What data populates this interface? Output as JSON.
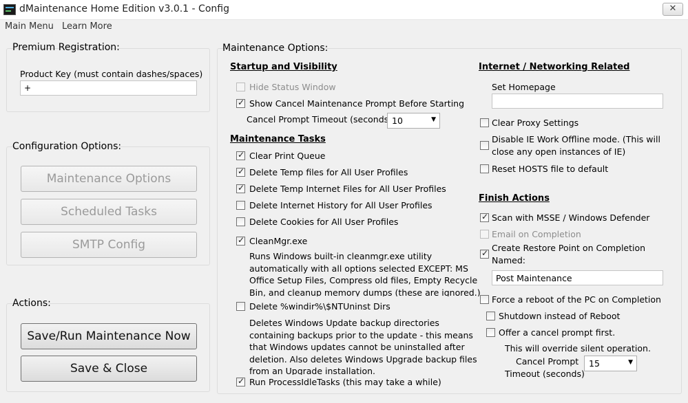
{
  "window": {
    "title": "dMaintenance Home Edition   v3.0.1  -  Config",
    "close_glyph": "✕"
  },
  "menu": {
    "items": [
      "Main Menu",
      "Learn More"
    ]
  },
  "premium": {
    "title": "Premium Registration:",
    "product_key_label": "Product Key  (must contain dashes/spaces)",
    "product_key_value": "+"
  },
  "config": {
    "title": "Configuration Options:",
    "buttons": [
      "Maintenance Options",
      "Scheduled Tasks",
      "SMTP Config"
    ]
  },
  "actions": {
    "title": "Actions:",
    "buttons": [
      "Save/Run Maintenance Now",
      "Save & Close"
    ]
  },
  "maintenance": {
    "title": "Maintenance Options:",
    "startup": {
      "heading": "Startup and Visibility",
      "hide_status": {
        "label": "Hide Status Window",
        "checked": false,
        "disabled": true
      },
      "show_cancel": {
        "label": "Show Cancel Maintenance Prompt Before Starting",
        "checked": true
      },
      "timeout_label": "Cancel Prompt Timeout (seconds)",
      "timeout_value": "10"
    },
    "tasks": {
      "heading": "Maintenance Tasks",
      "clear_print": {
        "label": "Clear Print Queue",
        "checked": true
      },
      "del_temp": {
        "label": "Delete Temp files for All User Profiles",
        "checked": true
      },
      "del_temp_inet": {
        "label": "Delete Temp Internet Files for All User Profiles",
        "checked": true
      },
      "del_history": {
        "label": "Delete Internet History for All User Profiles",
        "checked": false
      },
      "del_cookies": {
        "label": "Delete Cookies for All User Profiles",
        "checked": false
      },
      "cleanmgr": {
        "label": "CleanMgr.exe",
        "checked": true,
        "desc": "Runs Windows built-in cleanmgr.exe utility automatically with all options selected EXCEPT:  MS Office Setup Files, Compress old files, Empty Recycle Bin, and cleanup memory dumps (these are ignored.)"
      },
      "ntuninst": {
        "label": "Delete %windir%\\$NTUninst Dirs",
        "checked": false,
        "desc": "Deletes Windows Update backup directories containing backups prior to the update - this means that Windows updates cannot be uninstalled after deletion.  Also deletes Windows Upgrade backup files from an Upgrade installation."
      },
      "idle_tasks": {
        "label": "Run ProcessIdleTasks  (this may take a while)",
        "checked": true
      }
    },
    "internet": {
      "heading": "Internet / Networking Related",
      "homepage_label": "Set Homepage",
      "homepage_value": "",
      "clear_proxy": {
        "label": "Clear Proxy Settings",
        "checked": false
      },
      "ie_offline": {
        "line1": "Disable IE Work Offline mode.  (This will",
        "line2": "close any open instances of IE)",
        "checked": false
      },
      "reset_hosts": {
        "label": "Reset HOSTS file to default",
        "checked": false
      }
    },
    "finish": {
      "heading": "Finish Actions",
      "scan": {
        "label": "Scan with MSSE / Windows Defender",
        "checked": true
      },
      "email": {
        "label": "Email on Completion",
        "checked": false,
        "disabled": true
      },
      "restore": {
        "line1": "Create Restore Point on Completion",
        "line2": "Named:",
        "checked": true
      },
      "restore_name": "Post Maintenance",
      "reboot": {
        "label": "Force a reboot of the PC on Completion",
        "checked": false
      },
      "shutdown": {
        "label": "Shutdown instead of Reboot",
        "checked": false
      },
      "offer_cancel": {
        "label": "Offer a cancel prompt first.",
        "checked": false
      },
      "override_note": "This will override silent operation.",
      "cancel_timeout_line1": "Cancel Prompt",
      "cancel_timeout_line2": "Timeout (seconds)",
      "cancel_timeout_value": "15"
    }
  }
}
